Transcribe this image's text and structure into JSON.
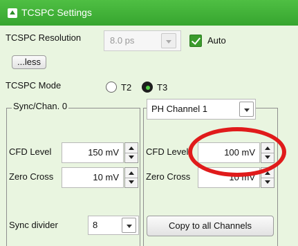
{
  "header": {
    "title": "TCSPC Settings"
  },
  "resolution": {
    "label": "TCSPC Resolution",
    "value": "8.0 ps",
    "auto_label": "Auto",
    "auto_checked": true
  },
  "less_button": "...less",
  "mode": {
    "label": "TCSPC Mode",
    "options": [
      "T2",
      "T3"
    ],
    "selected": "T3"
  },
  "sync_group": {
    "title": "Sync/Chan. 0",
    "cfd_label": "CFD Level",
    "cfd_value": "150 mV",
    "zero_label": "Zero Cross",
    "zero_value": "10 mV",
    "divider_label": "Sync divider",
    "divider_value": "8"
  },
  "channel_group": {
    "channel_select": "PH Channel 1",
    "cfd_label": "CFD Level",
    "cfd_value": "100 mV",
    "zero_label": "Zero Cross",
    "zero_value": "10 mV",
    "copy_button": "Copy to all Channels"
  },
  "colors": {
    "header": "#3eb136",
    "background": "#e9f5e0",
    "annotation": "#e01b1b"
  }
}
